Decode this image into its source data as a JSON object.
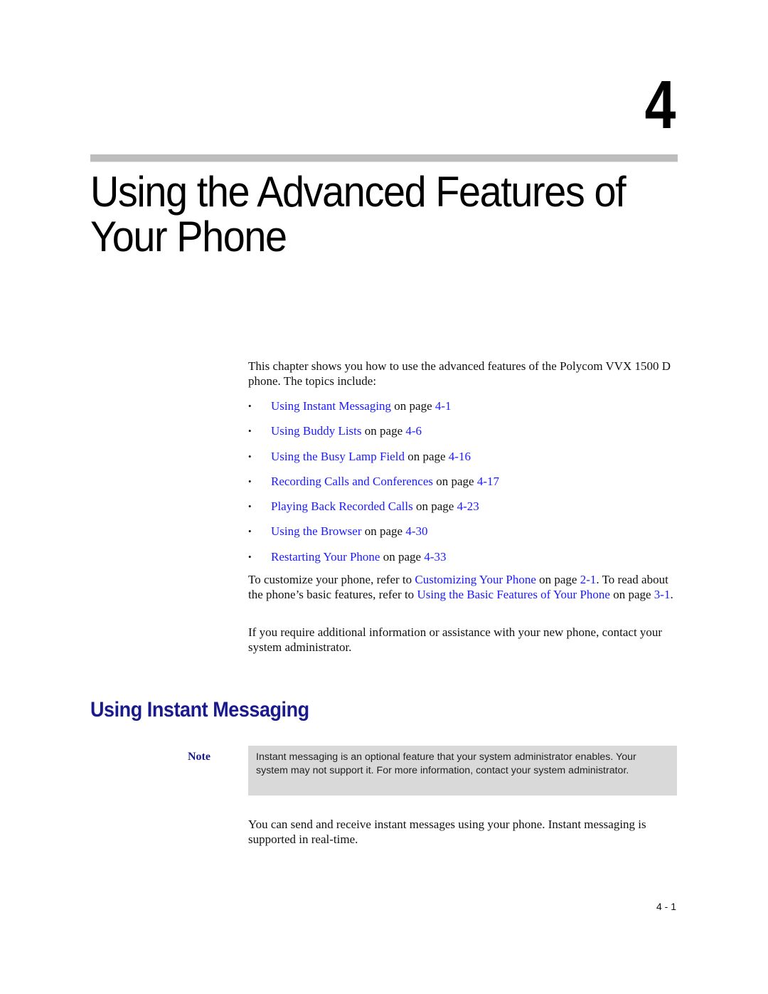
{
  "chapter": {
    "number": "4",
    "title": "Using the Advanced Features of Your Phone"
  },
  "intro": {
    "text": "This chapter shows you how to use the advanced features of the Polycom VVX 1500 D phone. The topics include:"
  },
  "topics": [
    {
      "link": "Using Instant Messaging",
      "on_page": " on page ",
      "page": "4-1"
    },
    {
      "link": "Using Buddy Lists",
      "on_page": " on page ",
      "page": "4-6"
    },
    {
      "link": "Using the Busy Lamp Field",
      "on_page": " on page ",
      "page": "4-16"
    },
    {
      "link": "Recording Calls and Conferences",
      "on_page": " on page ",
      "page": "4-17"
    },
    {
      "link": "Playing Back Recorded Calls",
      "on_page": " on page ",
      "page": "4-23"
    },
    {
      "link": "Using the Browser",
      "on_page": " on page ",
      "page": "4-30"
    },
    {
      "link": "Restarting Your Phone",
      "on_page": " on page ",
      "page": "4-33"
    }
  ],
  "bullet_glyph": "•",
  "customize_paragraph": {
    "t1": "To customize your phone, refer to ",
    "link1": "Customizing Your Phone",
    "t2": " on page ",
    "page1": "2-1",
    "t3": ". To read about the phone’s basic features, refer to ",
    "link2": "Using the Basic Features of Your Phone",
    "t4": " on page ",
    "page2": "3-1",
    "t5": "."
  },
  "assist_paragraph": {
    "text": "If you require additional information or assistance with your new phone, contact your system administrator."
  },
  "section": {
    "heading": "Using Instant Messaging",
    "note_label": "Note",
    "note_text": "Instant messaging is an optional feature that your system administrator enables. Your system may not support it. For more information, contact your system administrator.",
    "body": "You can send and receive instant messages using your phone. Instant messaging is supported in real-time."
  },
  "footer": {
    "page_number": "4 - 1"
  },
  "colors": {
    "link": "#1a1aff",
    "heading": "#1a1a8c",
    "rule": "#bdbdbd",
    "note_background": "#d9d9d9"
  }
}
